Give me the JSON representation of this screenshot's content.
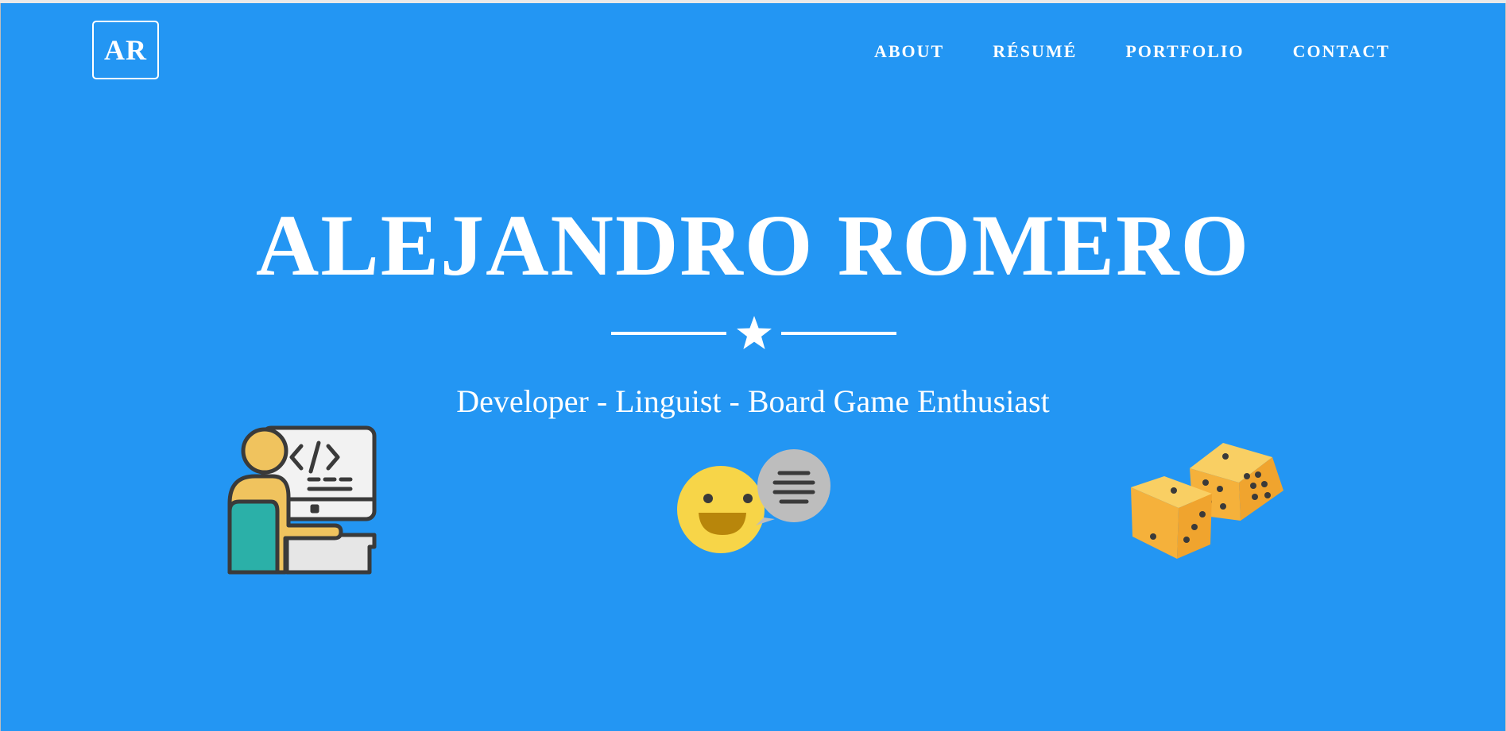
{
  "header": {
    "logo_text": "AR",
    "nav": [
      {
        "label": "ABOUT"
      },
      {
        "label": "RÉSUMÉ"
      },
      {
        "label": "PORTFOLIO"
      },
      {
        "label": "CONTACT"
      }
    ]
  },
  "hero": {
    "name": "ALEJANDRO ROMERO",
    "divider_icon": "star-icon",
    "tagline": "Developer - Linguist - Board Game Enthusiast"
  },
  "illustrations": [
    {
      "icon": "developer-at-computer-icon"
    },
    {
      "icon": "smiley-speech-bubble-icon"
    },
    {
      "icon": "dice-icon"
    }
  ],
  "colors": {
    "background": "#2396f3",
    "text": "#ffffff",
    "accent_yellow": "#f5c35a",
    "teal": "#2bb0a8"
  }
}
